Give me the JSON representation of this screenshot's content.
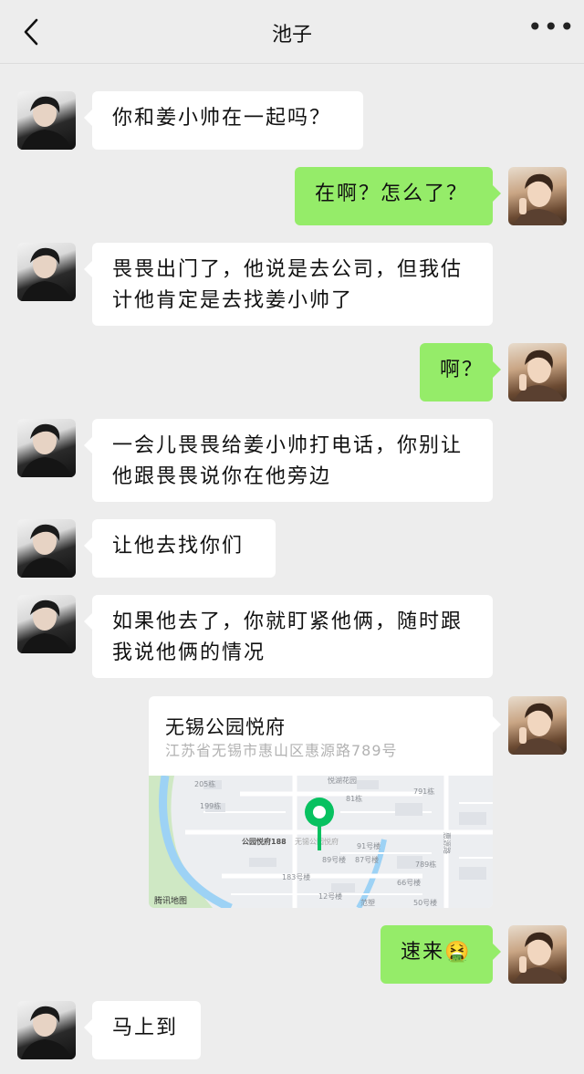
{
  "header": {
    "title": "池子"
  },
  "messages": [
    {
      "side": "in",
      "text": "你和姜小帅在一起吗？"
    },
    {
      "side": "out",
      "text": "在啊？怎么了？"
    },
    {
      "side": "in",
      "text": "畏畏出门了，他说是去公司，但我估计他肯定是去找姜小帅了"
    },
    {
      "side": "out",
      "text": "啊？"
    },
    {
      "side": "in",
      "text": "一会儿畏畏给姜小帅打电话，你别让他跟畏畏说你在他旁边"
    },
    {
      "side": "in",
      "text": "让他去找你们"
    },
    {
      "side": "in",
      "text": "如果他去了，你就盯紧他俩，随时跟我说他俩的情况"
    },
    {
      "side": "out",
      "text": "速来",
      "emoji": "🤮"
    },
    {
      "side": "in",
      "text": "马上到"
    }
  ],
  "location": {
    "name": "无锡公园悦府",
    "address": "江苏省无锡市惠山区惠源路789号",
    "map_labels": [
      "悦湖花园",
      "205栋",
      "199栋",
      "81栋",
      "791栋",
      "公园悦府188",
      "无锡公园悦府",
      "91号楼",
      "89号楼",
      "87号楼",
      "789栋",
      "183号楼",
      "66号楼",
      "12号楼",
      "50号楼",
      "惠源路",
      "范塑"
    ],
    "map_brand": "腾讯地图"
  },
  "colors": {
    "background": "#ededed",
    "outgoing_bubble": "#95ec69",
    "incoming_bubble": "#ffffff",
    "map_pin": "#07c160"
  },
  "icons": {
    "back": "chevron-left-icon",
    "more": "more-dots-icon"
  }
}
